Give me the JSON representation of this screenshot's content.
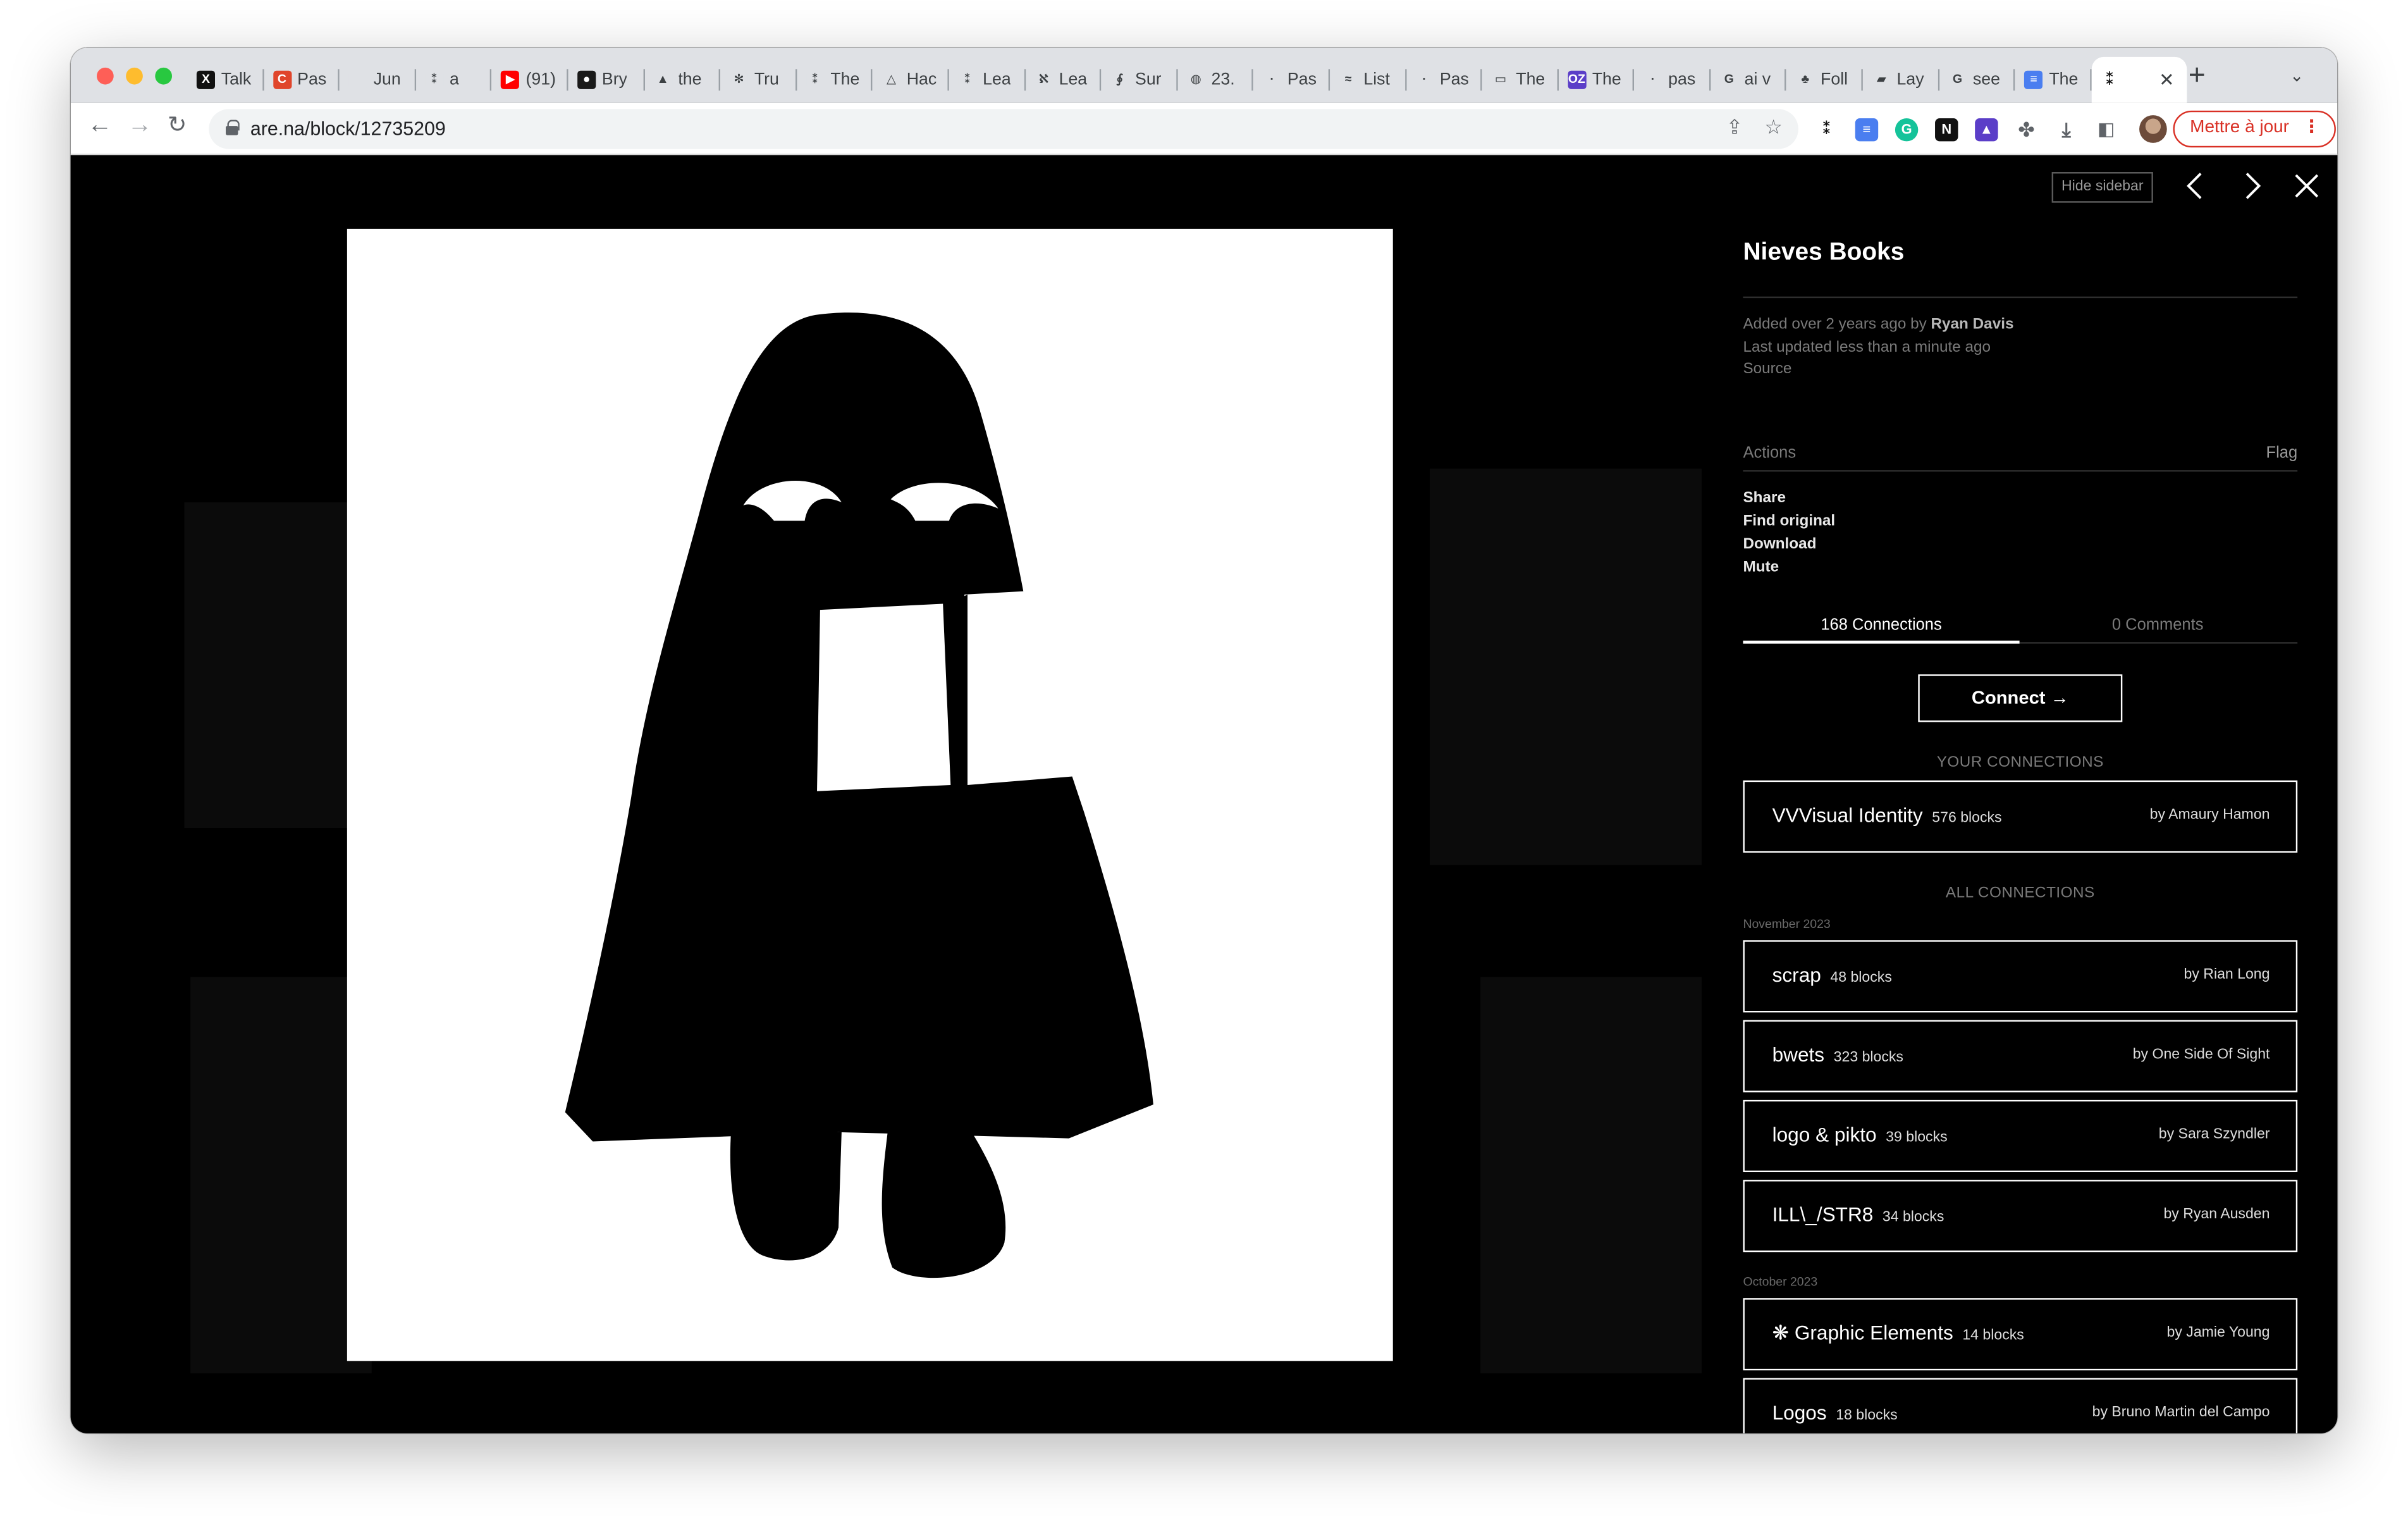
{
  "browser": {
    "tabs": [
      {
        "label": "Talk",
        "icon": "x-logo-icon",
        "color": "#111111",
        "glyph": "X"
      },
      {
        "label": "Pas",
        "icon": "red-square-icon",
        "color": "#e0452b",
        "glyph": "C"
      },
      {
        "label": "Jun",
        "icon": "blank-icon",
        "color": "#dfe1e5",
        "glyph": ""
      },
      {
        "label": "a",
        "icon": "double-asterisk-icon",
        "color": "#dfe1e5",
        "glyph": "⁑"
      },
      {
        "label": "(91)",
        "icon": "youtube-icon",
        "color": "#ff0000",
        "glyph": "▶"
      },
      {
        "label": "Bry",
        "icon": "red-circle-icon",
        "color": "#1a1a1a",
        "glyph": "●"
      },
      {
        "label": "the",
        "icon": "rocket-icon",
        "color": "#dfe1e5",
        "glyph": "▲"
      },
      {
        "label": "Tru",
        "icon": "snowflake-icon",
        "color": "#dfe1e5",
        "glyph": "✻"
      },
      {
        "label": "The",
        "icon": "double-asterisk-icon",
        "color": "#dfe1e5",
        "glyph": "⁑"
      },
      {
        "label": "Hac",
        "icon": "triangle-icon",
        "color": "#dfe1e5",
        "glyph": "△"
      },
      {
        "label": "Lea",
        "icon": "double-asterisk-icon",
        "color": "#dfe1e5",
        "glyph": "⁑"
      },
      {
        "label": "Lea",
        "icon": "scribble-icon",
        "color": "#dfe1e5",
        "glyph": "ℵ"
      },
      {
        "label": "Sur",
        "icon": "feather-icon",
        "color": "#dfe1e5",
        "glyph": "∮"
      },
      {
        "label": "23.",
        "icon": "globe-icon",
        "color": "#dfe1e5",
        "glyph": "◍"
      },
      {
        "label": "Pas",
        "icon": "dot-icon",
        "color": "#dfe1e5",
        "glyph": "·"
      },
      {
        "label": "List",
        "icon": "tailwind-icon",
        "color": "#dfe1e5",
        "glyph": "≈"
      },
      {
        "label": "Pas",
        "icon": "dot-icon",
        "color": "#dfe1e5",
        "glyph": "·"
      },
      {
        "label": "The",
        "icon": "image-icon",
        "color": "#dfe1e5",
        "glyph": "▭"
      },
      {
        "label": "The",
        "icon": "oz-icon",
        "color": "#5b3ec8",
        "glyph": "OZ"
      },
      {
        "label": "pas",
        "icon": "dot-icon",
        "color": "#dfe1e5",
        "glyph": "·"
      },
      {
        "label": "ai v",
        "icon": "google-icon",
        "color": "#dfe1e5",
        "glyph": "G"
      },
      {
        "label": "Foll",
        "icon": "plant-icon",
        "color": "#dfe1e5",
        "glyph": "♣"
      },
      {
        "label": "Lay",
        "icon": "folder-icon",
        "color": "#dfe1e5",
        "glyph": "▰"
      },
      {
        "label": "see",
        "icon": "google-icon",
        "color": "#dfe1e5",
        "glyph": "G"
      },
      {
        "label": "The",
        "icon": "docs-icon",
        "color": "#4a7ef0",
        "glyph": "≡"
      }
    ],
    "active_tab": {
      "label": "",
      "icon": "double-asterisk-icon"
    },
    "url": "are.na/block/12735209",
    "update_label": "Mettre à jour"
  },
  "sidebar": {
    "hide_label": "Hide sidebar",
    "title": "Nieves Books",
    "added_prefix": "Added over 2 years ago by ",
    "added_by": "Ryan Davis",
    "updated": "Last updated less than a minute ago",
    "source": "Source",
    "actions_label": "Actions",
    "flag_label": "Flag",
    "actions": [
      "Share",
      "Find original",
      "Download",
      "Mute"
    ],
    "tabs": {
      "connections": "168 Connections",
      "comments": "0 Comments"
    },
    "connect_label": "Connect →",
    "your_connections_label": "YOUR CONNECTIONS",
    "your_connections": [
      {
        "title": "VVVisual Identity",
        "count": "576 blocks",
        "by": "by Amaury Hamon"
      }
    ],
    "all_connections_label": "ALL CONNECTIONS",
    "groups": [
      {
        "date": "November 2023",
        "items": [
          {
            "title": "scrap",
            "count": "48 blocks",
            "by": "by Rian Long"
          },
          {
            "title": "bwets",
            "count": "323 blocks",
            "by": "by One Side Of Sight"
          },
          {
            "title": "logo & pikto",
            "count": "39 blocks",
            "by": "by Sara Szyndler"
          },
          {
            "title": "ILL\\_/STR8",
            "count": "34 blocks",
            "by": "by Ryan Ausden"
          }
        ]
      },
      {
        "date": "October 2023",
        "items": [
          {
            "title": "❋ Graphic Elements",
            "count": "14 blocks",
            "by": "by Jamie Young"
          },
          {
            "title": "Logos",
            "count": "18 blocks",
            "by": "by Bruno Martin del Campo"
          }
        ]
      }
    ]
  }
}
